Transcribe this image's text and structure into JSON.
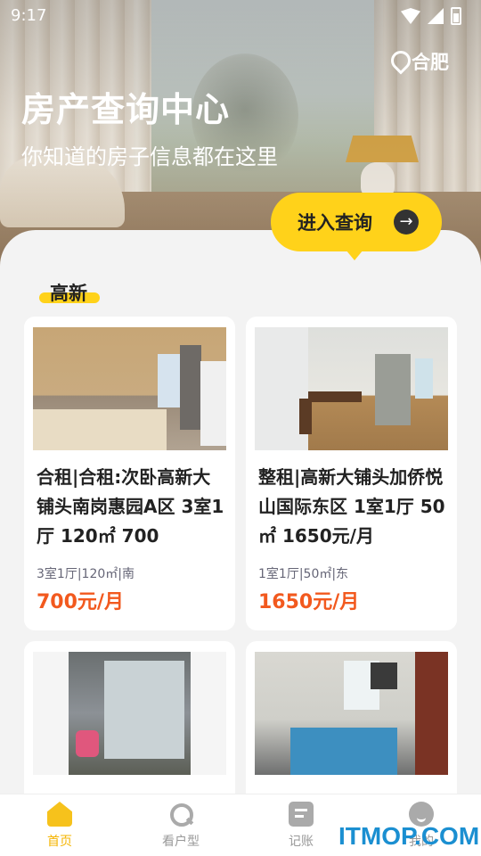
{
  "status_bar": {
    "time": "9:17"
  },
  "header": {
    "city": "合肥",
    "title": "房产查询中心",
    "subtitle": "你知道的房子信息都在这里",
    "query_button": "进入查询"
  },
  "district": {
    "label": "高新"
  },
  "listings": [
    {
      "title": "合租|合租:次卧高新大铺头南岗惠园A区 3室1厅 120㎡ 700",
      "meta": "3室1厅|120㎡|南",
      "price": "700元/月"
    },
    {
      "title": "整租|高新大铺头加侨悦山国际东区 1室1厅 50㎡ 1650元/月",
      "meta": "1室1厅|50㎡|东",
      "price": "1650元/月"
    },
    {
      "title": "",
      "meta": "",
      "price": ""
    },
    {
      "title": "",
      "meta": "",
      "price": ""
    }
  ],
  "tabbar": {
    "tabs": [
      {
        "label": "首页",
        "icon": "home-icon",
        "active": true
      },
      {
        "label": "看户型",
        "icon": "search-icon",
        "active": false
      },
      {
        "label": "记账",
        "icon": "notebook-icon",
        "active": false
      },
      {
        "label": "我的",
        "icon": "profile-icon",
        "active": false
      }
    ]
  },
  "watermark": "ITMOP.COM",
  "colors": {
    "accent": "#ffd21a",
    "price": "#f2591e",
    "tab_active": "#f5b400"
  }
}
